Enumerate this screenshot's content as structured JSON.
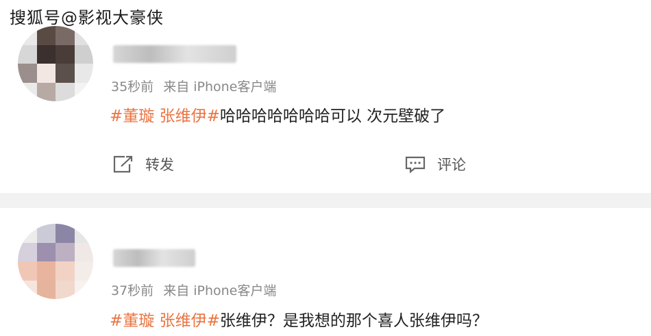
{
  "watermark": "搜狐号@影视大豪侠",
  "posts": [
    {
      "time": "35秒前",
      "source": "来自 iPhone客户端",
      "tags": "#董璇 张维伊#",
      "text": "哈哈哈哈哈哈哈可以 次元壁破了",
      "actions": {
        "repost": "转发",
        "comment": "评论"
      }
    },
    {
      "time": "37秒前",
      "source": "来自 iPhone客户端",
      "tags": "#董璇 张维伊#",
      "text": "张维伊？是我想的那个喜人张维伊吗？"
    }
  ],
  "colors": {
    "tag": "#eb7340",
    "meta": "#888888",
    "text": "#222222",
    "divider": "#f2f2f2"
  },
  "icons": {
    "repost": "share-square-icon",
    "comment": "comment-bubble-icon"
  }
}
